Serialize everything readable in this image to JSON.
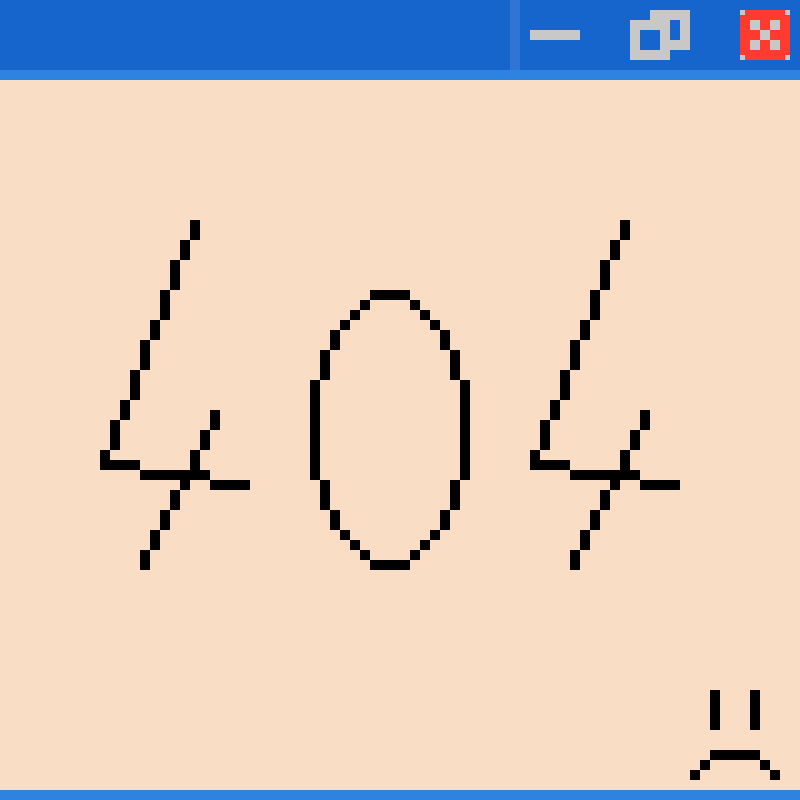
{
  "error": {
    "code": "404",
    "mood_icon": "sad-face-icon"
  },
  "window_controls": {
    "minimize_icon": "minimize-icon",
    "restore_icon": "restore-icon",
    "close_icon": "close-icon"
  },
  "colors": {
    "titlebar": "#1565cd",
    "titlebar_accent": "#2f83e0",
    "background": "#f9dec5",
    "ink": "#000000",
    "control_gray": "#c8c8c8",
    "close_red": "#ff3b30"
  }
}
